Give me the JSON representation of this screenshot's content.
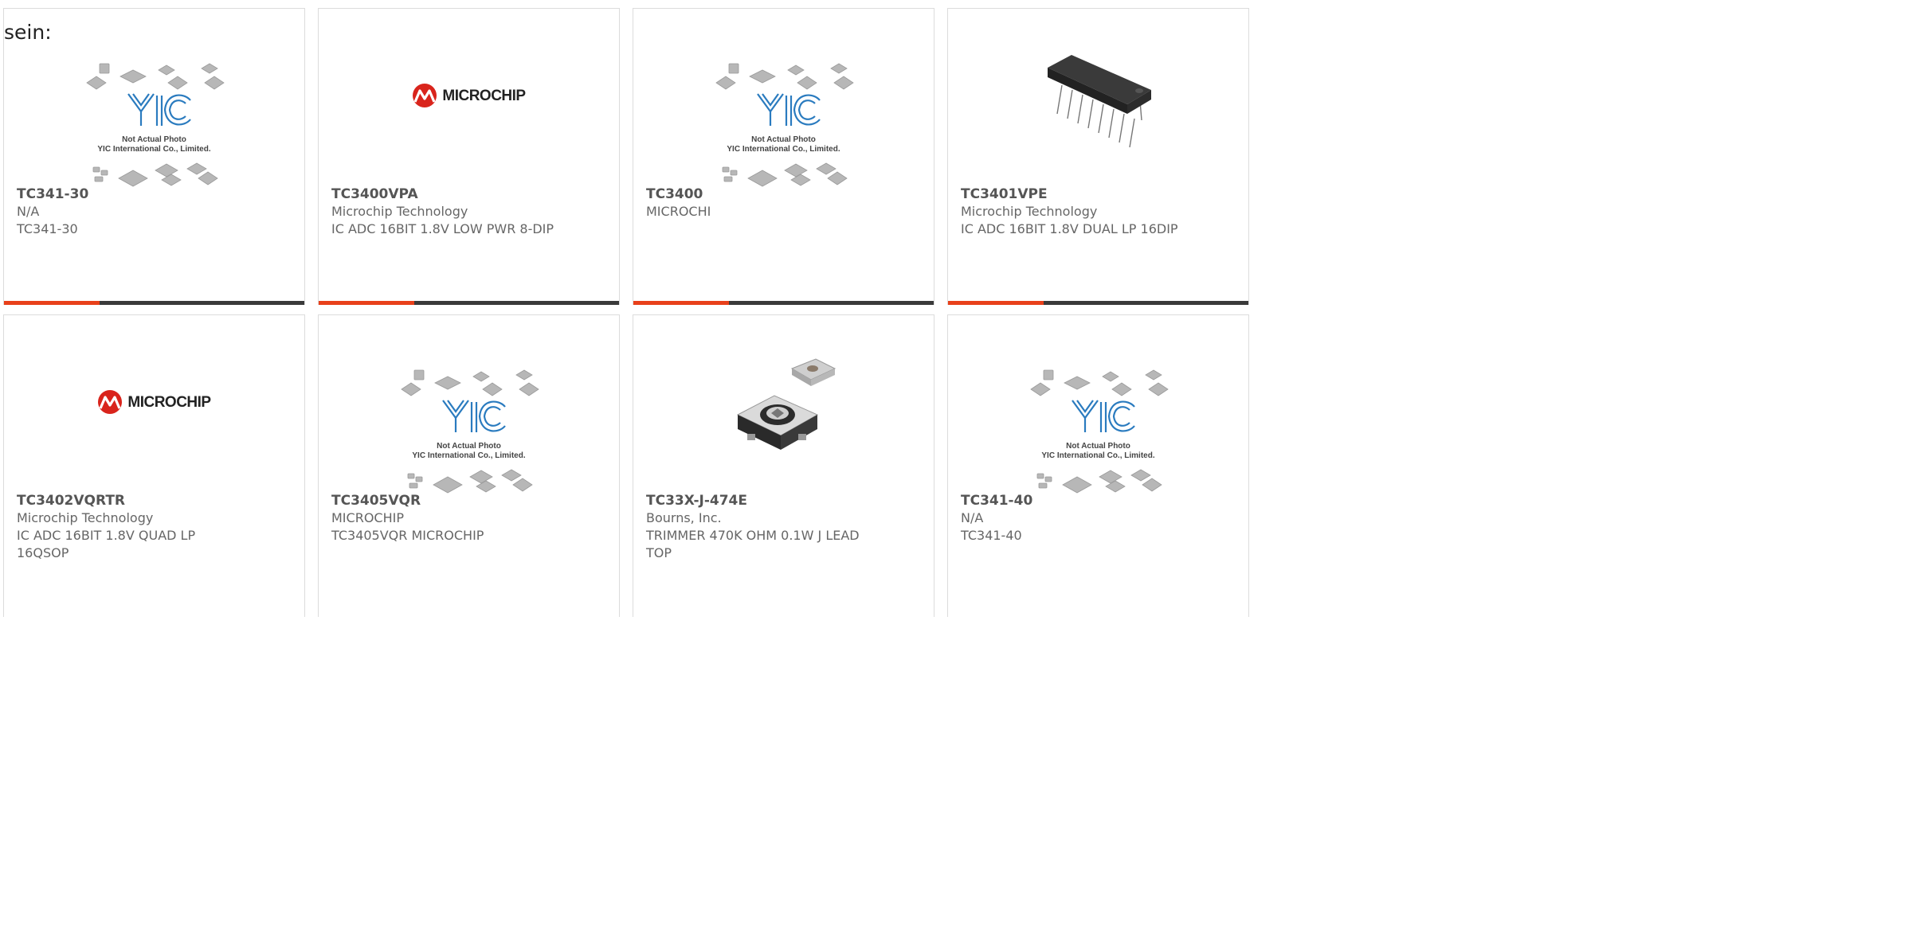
{
  "intro_text": "sein:",
  "placeholder_image": {
    "line1": "Not Actual Photo",
    "line2": "YIC International Co., Limited."
  },
  "brand_logo_text": "MICROCHIP",
  "colors": {
    "accent": "#e8401a",
    "bar": "#3a3a3a",
    "yic_blue": "#2a7bbf",
    "microchip_red": "#d9241c"
  },
  "products": [
    {
      "part": "TC341-30",
      "maker": "N/A",
      "desc": "TC341-30",
      "image": "yic-placeholder-image"
    },
    {
      "part": "TC3400VPA",
      "maker": "Microchip Technology",
      "desc": "IC ADC 16BIT 1.8V LOW PWR 8-DIP",
      "image": "microchip-logo"
    },
    {
      "part": "TC3400",
      "maker": "MICROCHI",
      "desc": "",
      "image": "yic-placeholder-image"
    },
    {
      "part": "TC3401VPE",
      "maker": "Microchip Technology",
      "desc": "IC ADC 16BIT 1.8V DUAL LP 16DIP",
      "image": "dip-chip-photo"
    },
    {
      "part": "TC3402VQRTR",
      "maker": "Microchip Technology",
      "desc": "IC ADC 16BIT 1.8V QUAD LP 16QSOP",
      "image": "microchip-logo"
    },
    {
      "part": "TC3405VQR",
      "maker": "MICROCHIP",
      "desc": "TC3405VQR MICROCHIP",
      "image": "yic-placeholder-image"
    },
    {
      "part": "TC33X-J-474E",
      "maker": "Bourns, Inc.",
      "desc": "TRIMMER 470K OHM 0.1W J LEAD TOP",
      "image": "trimmer-photo"
    },
    {
      "part": "TC341-40",
      "maker": "N/A",
      "desc": "TC341-40",
      "image": "yic-placeholder-image"
    }
  ]
}
